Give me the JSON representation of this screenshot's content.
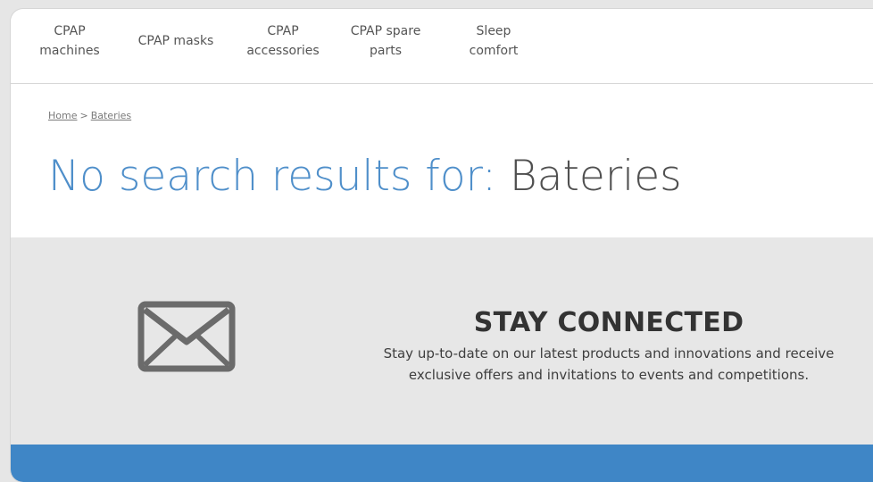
{
  "nav": {
    "items": [
      {
        "label": "CPAP\nmachines"
      },
      {
        "label": "CPAP masks"
      },
      {
        "label": "CPAP\naccessories"
      },
      {
        "label": "CPAP spare\nparts"
      },
      {
        "label": "Sleep\ncomfort"
      }
    ]
  },
  "breadcrumb": {
    "home": "Home",
    "separator": ">",
    "current": "Bateries"
  },
  "results": {
    "prefix": "No search results for:",
    "query": "Bateries"
  },
  "newsletter": {
    "icon": "envelope-icon",
    "title": "STAY CONNECTED",
    "text": "Stay up-to-date on our latest products and innovations and receive exclusive offers and invitations to events and competitions."
  },
  "colors": {
    "accent_blue": "#4f8fca",
    "footer_blue": "#3f86c6",
    "newsletter_bg": "#e7e7e7"
  }
}
